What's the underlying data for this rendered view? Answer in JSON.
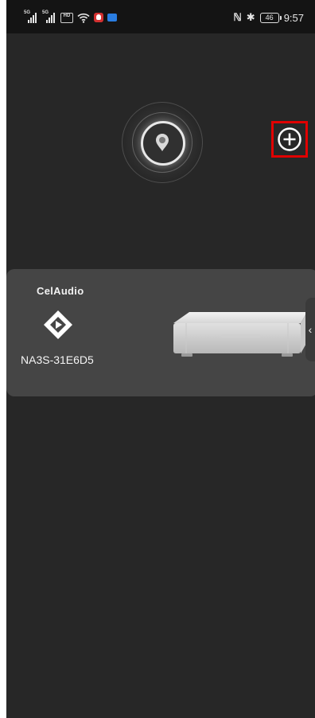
{
  "status_bar": {
    "signal_1_tag": "5G",
    "signal_2_tag": "5G",
    "hd_label": "HD",
    "battery_level": "46",
    "time": "9:57",
    "icons": [
      "signal-5g-icon",
      "signal-5g-icon",
      "hd-icon",
      "wifi-icon",
      "qq-app-icon",
      "blue-app-icon",
      "nfc-icon",
      "bluetooth-icon",
      "battery-icon"
    ]
  },
  "search": {
    "indicator_icon": "radar-search-icon",
    "add_icon": "plus-circle-icon",
    "highlight_color": "#e10000"
  },
  "device": {
    "brand": "CelAudio",
    "logo_icon": "celaudio-logo-icon",
    "name": "NA3S-31E6D5",
    "image_icon": "network-streamer-device-image",
    "expand_icon": "chevron-left-icon"
  },
  "colors": {
    "background": "#272727",
    "status_bar": "#141414",
    "card": "#454545",
    "text": "#f2f2f2"
  }
}
